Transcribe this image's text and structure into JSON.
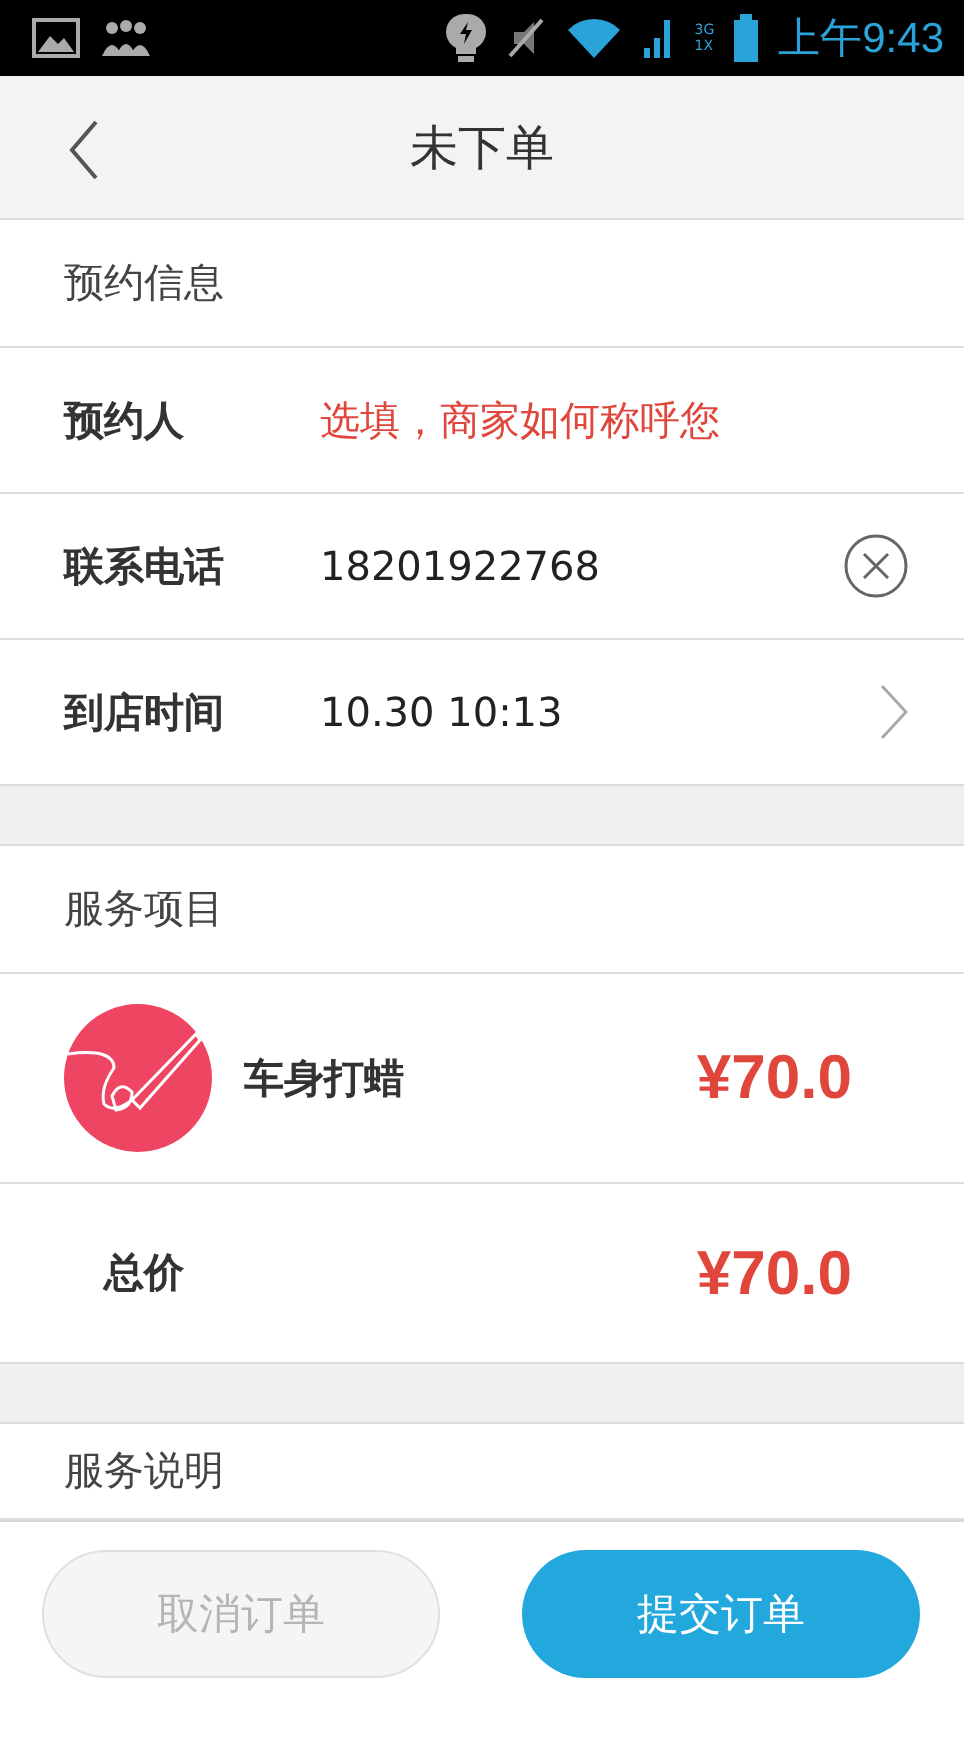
{
  "status_bar": {
    "network_top": "3G",
    "network_bottom": "1X",
    "time": "上午9:43"
  },
  "header": {
    "title": "未下单"
  },
  "booking": {
    "title": "预约信息",
    "fields": [
      {
        "kind": "input",
        "label": "预约人",
        "placeholder": "选填，商家如何称呼您"
      },
      {
        "kind": "clearable",
        "label": "联系电话",
        "value": "18201922768"
      },
      {
        "kind": "picker",
        "label": "到店时间",
        "value": "10.30 10:13"
      }
    ]
  },
  "service": {
    "title": "服务项目",
    "item": {
      "name": "车身打蜡",
      "price": "¥70.0"
    },
    "total_label": "总价",
    "total": "¥70.0"
  },
  "notes": {
    "title": "服务说明"
  },
  "buttons": [
    {
      "kind": "cancel",
      "label": "取消订单",
      "disabled": true
    },
    {
      "kind": "submit",
      "label": "提交订单",
      "disabled": false
    }
  ]
}
